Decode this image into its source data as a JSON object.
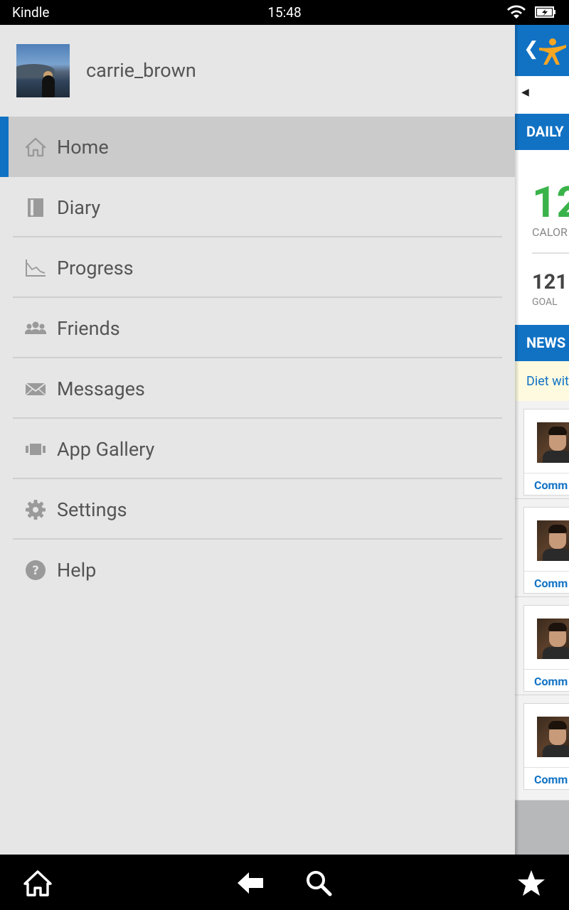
{
  "status_bar": {
    "carrier": "Kindle",
    "time": "15:48",
    "wifi_icon": "wifi-icon",
    "battery_icon": "battery-charging-icon"
  },
  "drawer": {
    "profile": {
      "username": "carrie_brown",
      "avatar_icon": "user-avatar"
    },
    "menu": [
      {
        "label": "Home",
        "icon": "home-icon",
        "active": true
      },
      {
        "label": "Diary",
        "icon": "diary-icon",
        "active": false
      },
      {
        "label": "Progress",
        "icon": "progress-chart-icon",
        "active": false
      },
      {
        "label": "Friends",
        "icon": "friends-icon",
        "active": false
      },
      {
        "label": "Messages",
        "icon": "envelope-icon",
        "active": false
      },
      {
        "label": "App Gallery",
        "icon": "app-gallery-icon",
        "active": false
      },
      {
        "label": "Settings",
        "icon": "gear-icon",
        "active": false
      },
      {
        "label": "Help",
        "icon": "help-icon",
        "active": false
      }
    ]
  },
  "background_page": {
    "back_symbol": "❮",
    "date_prev_symbol": "◀",
    "daily_section": "DAILY",
    "calories_value": "12",
    "calories_label": "CALOR",
    "goal_value": "121",
    "goal_label": "GOAL",
    "news_section": "NEWS",
    "tip_text": "Diet wit",
    "news_items": [
      {
        "comment": "Comm"
      },
      {
        "comment": "Comm"
      },
      {
        "comment": "Comm"
      },
      {
        "comment": "Comm"
      }
    ]
  },
  "nav_bar": {
    "home_icon": "home-icon",
    "back_icon": "back-arrow-icon",
    "search_icon": "search-icon",
    "favorites_icon": "star-icon"
  },
  "colors": {
    "accent": "#1172c4",
    "calories_green": "#3ab34a",
    "drawer_bg": "#e6e6e6",
    "active_item_bg": "#cbcbcb"
  }
}
